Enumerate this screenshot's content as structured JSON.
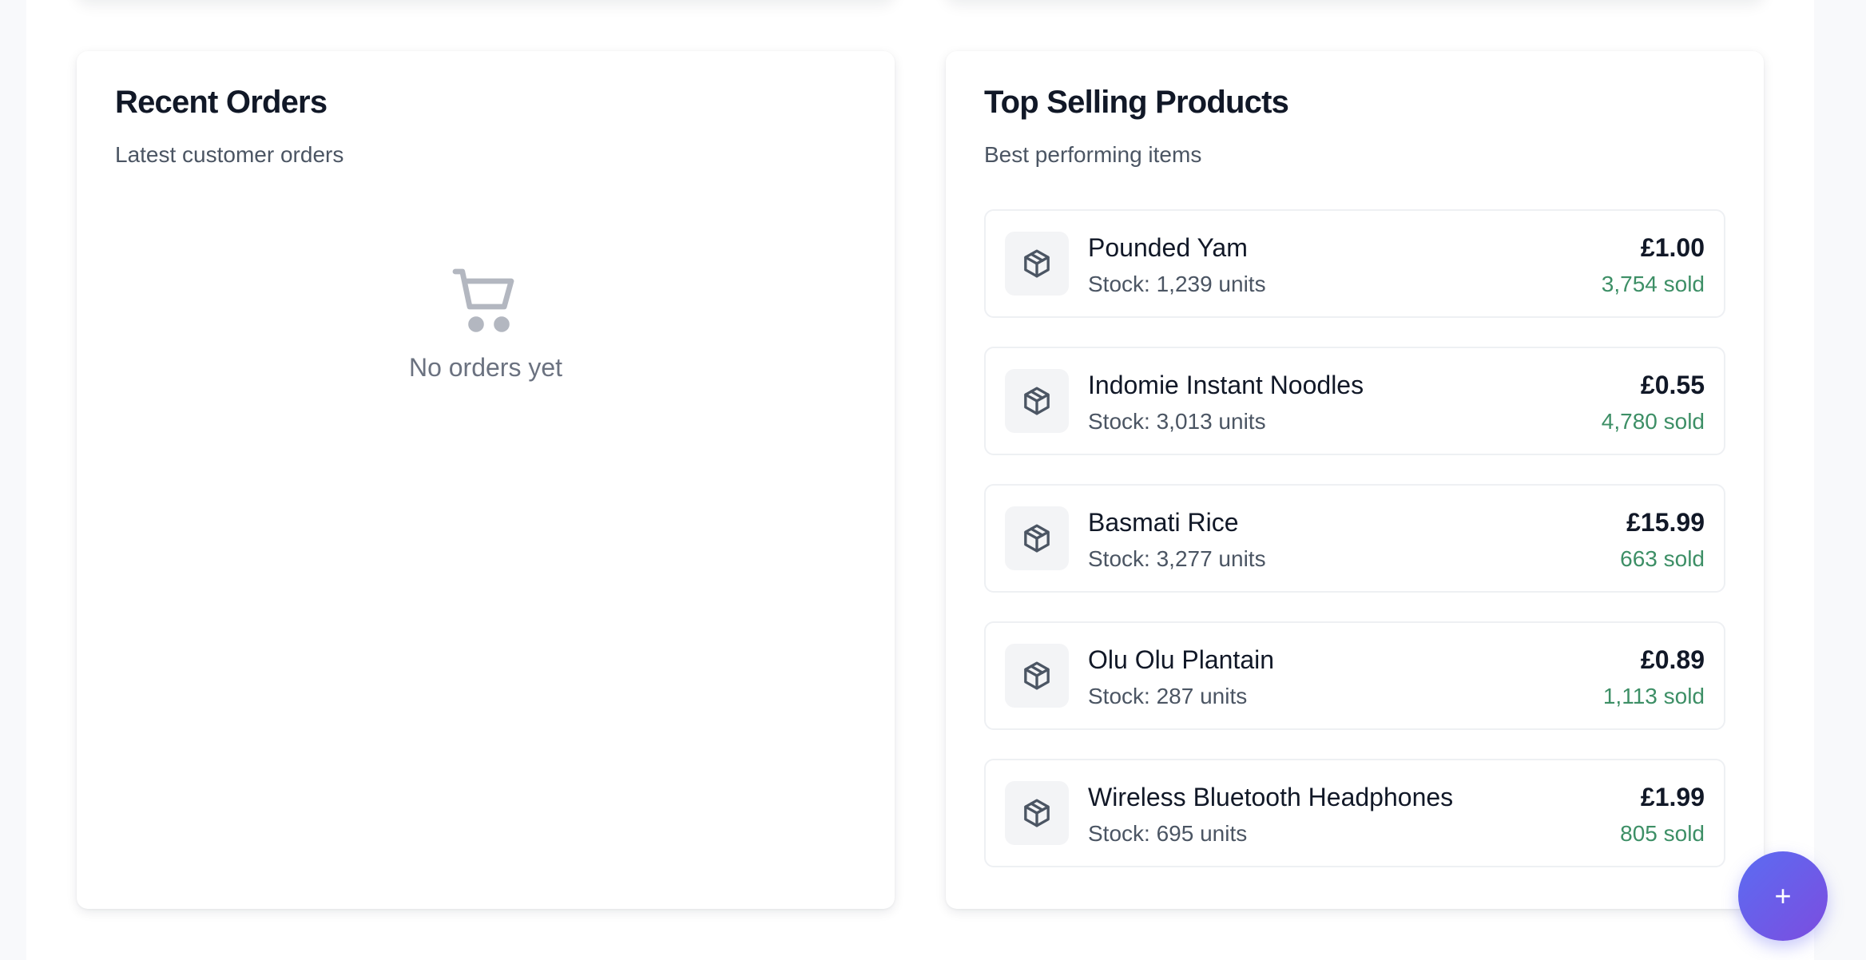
{
  "recent_orders": {
    "title": "Recent Orders",
    "subtitle": "Latest customer orders",
    "empty_icon": "shopping-cart-icon",
    "empty_text": "No orders yet"
  },
  "top_selling": {
    "title": "Top Selling Products",
    "subtitle": "Best performing items",
    "item_icon": "package-icon",
    "products": [
      {
        "name": "Pounded Yam",
        "stock": "Stock: 1,239 units",
        "price": "£1.00",
        "sold": "3,754 sold"
      },
      {
        "name": "Indomie Instant Noodles",
        "stock": "Stock: 3,013 units",
        "price": "£0.55",
        "sold": "4,780 sold"
      },
      {
        "name": "Basmati Rice",
        "stock": "Stock: 3,277 units",
        "price": "£15.99",
        "sold": "663 sold"
      },
      {
        "name": "Olu Olu Plantain",
        "stock": "Stock: 287 units",
        "price": "£0.89",
        "sold": "1,113 sold"
      },
      {
        "name": "Wireless Bluetooth Headphones",
        "stock": "Stock: 695 units",
        "price": "£1.99",
        "sold": "805 sold"
      }
    ]
  },
  "fab": {
    "label": "+",
    "icon": "plus-icon"
  },
  "colors": {
    "accent_start": "#5b6cf2",
    "accent_end": "#7c4ddf",
    "sold_green": "#3d8f66",
    "title_text": "#111827",
    "muted_text": "#4b5563"
  }
}
